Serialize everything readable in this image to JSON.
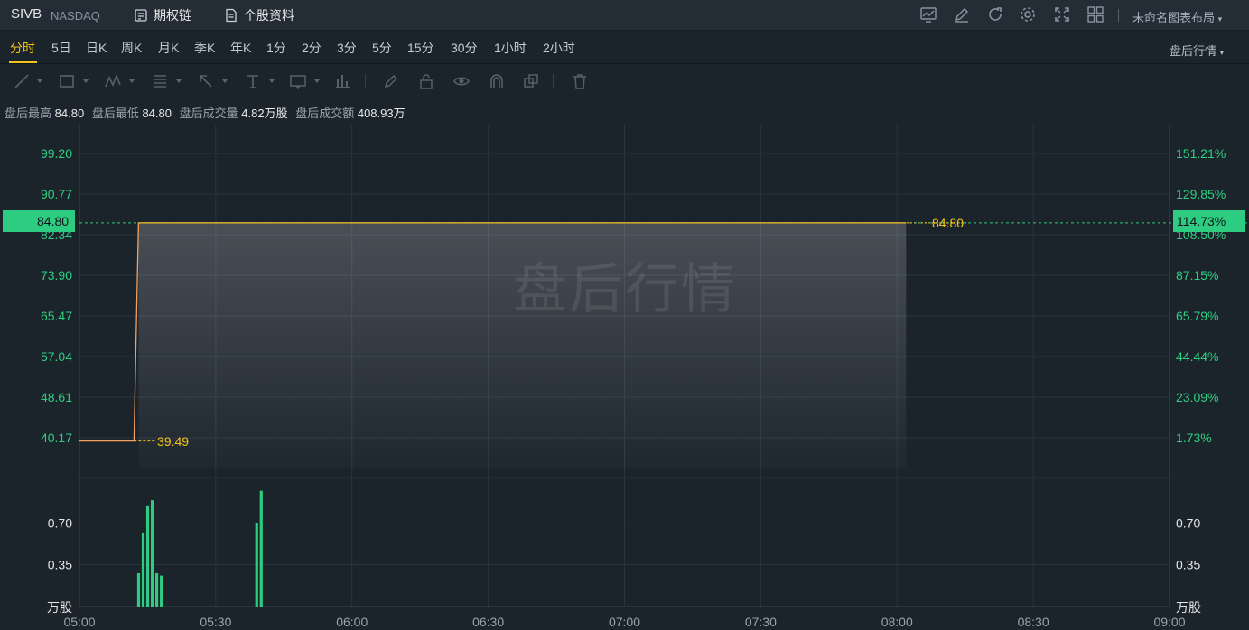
{
  "header": {
    "ticker": "SIVB",
    "exchange": "NASDAQ",
    "links": [
      {
        "label": "期权链",
        "icon": "option-chain-icon"
      },
      {
        "label": "个股资料",
        "icon": "document-icon"
      }
    ],
    "toolbar_icons": [
      "indicator-icon",
      "edit-icon",
      "refresh-icon",
      "settings-icon",
      "fullscreen-icon",
      "layout-grid-icon"
    ],
    "layout_name": "未命名图表布局"
  },
  "periods": {
    "items": [
      "分时",
      "5日",
      "日K",
      "周K",
      "月K",
      "季K",
      "年K",
      "1分",
      "2分",
      "3分",
      "5分",
      "15分",
      "30分",
      "1小时",
      "2小时"
    ],
    "selected": "分时",
    "mode": "盘后行情"
  },
  "drawing_tools": [
    "trend-line-icon",
    "rectangle-icon",
    "pattern-icon",
    "fib-icon",
    "arrow-icon",
    "text-icon",
    "label-icon",
    "bar-pattern-icon",
    "pencil-icon",
    "unlock-icon",
    "eye-icon",
    "magnet-icon",
    "clone-icon",
    "trash-icon"
  ],
  "info": {
    "high_label": "盘后最高",
    "high": "84.80",
    "low_label": "盘后最低",
    "low": "84.80",
    "vol_label": "盘后成交量",
    "vol": "4.82万股",
    "amt_label": "盘后成交额",
    "amt": "408.93万"
  },
  "chart": {
    "watermark": "盘后行情",
    "current_price": "84.80",
    "current_pct": "114.73%",
    "prev_close_label": "39.49",
    "last_price_label": "84.80",
    "volume_unit": "万股",
    "colors": {
      "up": "#2ecc80",
      "line": "#f4a261",
      "highlight": "#f0c419",
      "grid": "#2b353f"
    }
  },
  "chart_data": {
    "type": "line",
    "title": "",
    "price_axis_left": [
      "99.20",
      "90.77",
      "82.34",
      "73.90",
      "65.47",
      "57.04",
      "48.61",
      "40.17"
    ],
    "price_axis_right": [
      "151.21%",
      "129.85%",
      "108.50%",
      "87.15%",
      "65.79%",
      "44.44%",
      "23.09%",
      "1.73%"
    ],
    "volume_axis": [
      "0.70",
      "0.35"
    ],
    "x_ticks": [
      "05:00",
      "05:30",
      "06:00",
      "06:30",
      "07:00",
      "07:30",
      "08:00",
      "08:30",
      "09:00"
    ],
    "price_range": [
      40.17,
      99.2
    ],
    "series": [
      {
        "values_x": [
          "05:00",
          "05:12",
          "05:13",
          "08:02"
        ],
        "values_y": [
          39.49,
          39.49,
          84.8,
          84.8
        ]
      }
    ],
    "volume": [
      {
        "t": "05:13",
        "v": 0.28
      },
      {
        "t": "05:14",
        "v": 0.62
      },
      {
        "t": "05:15",
        "v": 0.84
      },
      {
        "t": "05:16",
        "v": 0.89
      },
      {
        "t": "05:17",
        "v": 0.28
      },
      {
        "t": "05:18",
        "v": 0.26
      },
      {
        "t": "05:39",
        "v": 0.7
      },
      {
        "t": "05:40",
        "v": 0.97
      }
    ],
    "volume_range": [
      0,
      1.05
    ]
  }
}
